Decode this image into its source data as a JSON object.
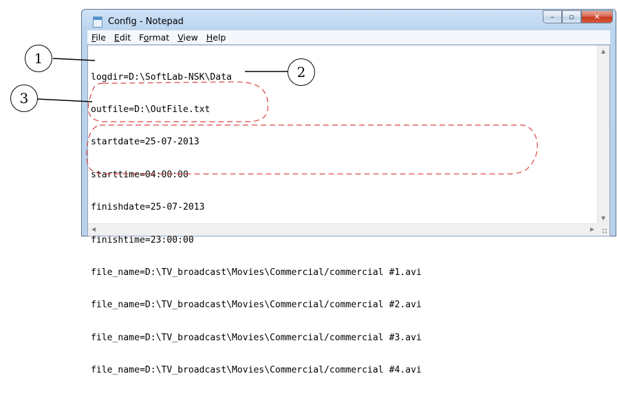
{
  "window": {
    "title": "Config - Notepad",
    "buttons": {
      "minimize": "–",
      "maximize": "▫",
      "close": "✕"
    }
  },
  "menu": [
    {
      "ul": "F",
      "rest": "ile"
    },
    {
      "ul": "E",
      "rest": "dit"
    },
    {
      "pre": "F",
      "ul": "o",
      "rest": "rmat"
    },
    {
      "ul": "V",
      "rest": "iew"
    },
    {
      "ul": "H",
      "rest": "elp"
    }
  ],
  "lines": [
    "logdir=D:\\SoftLab-NSK\\Data",
    "outfile=D:\\OutFile.txt",
    "startdate=25-07-2013",
    "starttime=04:00:00",
    "finishdate=25-07-2013",
    "finishtime=23:00:00",
    "file_name=D:\\TV_broadcast\\Movies\\Commercial/commercial #1.avi",
    "file_name=D:\\TV_broadcast\\Movies\\Commercial/commercial #2.avi",
    "file_name=D:\\TV_broadcast\\Movies\\Commercial/commercial #3.avi",
    "file_name=D:\\TV_broadcast\\Movies\\Commercial/commercial #4.avi"
  ],
  "callouts": {
    "c1": "1",
    "c2": "2",
    "c3": "3"
  }
}
